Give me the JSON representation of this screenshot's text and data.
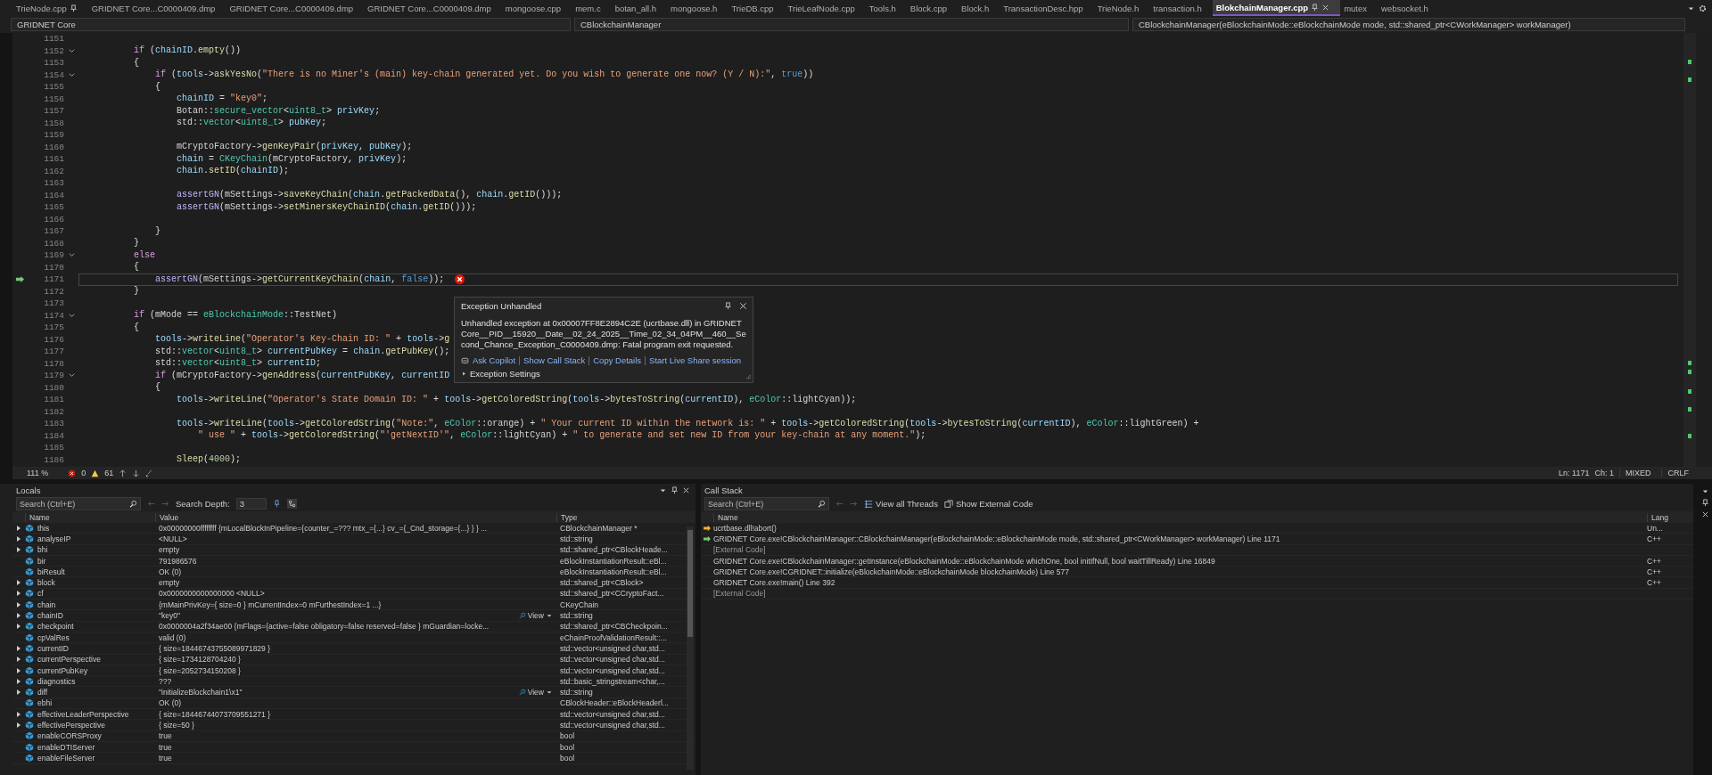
{
  "tabs": [
    {
      "label": "TrieNode.cpp",
      "selected": false,
      "pinned": true
    },
    {
      "label": "GRIDNET Core...C0000409.dmp",
      "selected": false,
      "pinned": false
    },
    {
      "label": "GRIDNET Core...C0000409.dmp",
      "selected": false,
      "pinned": false
    },
    {
      "label": "GRIDNET Core...C0000409.dmp",
      "selected": false,
      "pinned": false
    },
    {
      "label": "mongoose.cpp",
      "selected": false,
      "pinned": false
    },
    {
      "label": "mem.c",
      "selected": false,
      "pinned": false
    },
    {
      "label": "botan_all.h",
      "selected": false,
      "pinned": false
    },
    {
      "label": "mongoose.h",
      "selected": false,
      "pinned": false
    },
    {
      "label": "TrieDB.cpp",
      "selected": false,
      "pinned": false
    },
    {
      "label": "TrieLeafNode.cpp",
      "selected": false,
      "pinned": false
    },
    {
      "label": "Tools.h",
      "selected": false,
      "pinned": false
    },
    {
      "label": "Block.cpp",
      "selected": false,
      "pinned": false
    },
    {
      "label": "Block.h",
      "selected": false,
      "pinned": false
    },
    {
      "label": "TransactionDesc.hpp",
      "selected": false,
      "pinned": false
    },
    {
      "label": "TrieNode.h",
      "selected": false,
      "pinned": false
    },
    {
      "label": "transaction.h",
      "selected": false,
      "pinned": false
    },
    {
      "label": "BlokchainManager.cpp",
      "selected": true,
      "pinned": true
    },
    {
      "label": "mutex",
      "selected": false,
      "pinned": false
    },
    {
      "label": "websocket.h",
      "selected": false,
      "pinned": false
    }
  ],
  "nav_bar": {
    "project": "GRIDNET Core",
    "scope": "CBlockchainManager",
    "member": "CBlockchainManager(eBlockchainMode::eBlockchainMode mode, std::shared_ptr<CWorkManager> workManager)"
  },
  "editor": {
    "lines": [
      {
        "number": "1151",
        "fold": false,
        "current": false,
        "error": false
      },
      {
        "number": "1152",
        "fold": true,
        "current": false,
        "error": false,
        "tokens": [
          {
            "kind": "keyword",
            "text": "        if"
          },
          {
            "kind": "plain",
            "text": " ("
          },
          {
            "kind": "variable",
            "text": "chainID"
          },
          {
            "kind": "plain",
            "text": "."
          },
          {
            "kind": "function",
            "text": "empty"
          },
          {
            "kind": "plain",
            "text": "())"
          }
        ]
      },
      {
        "number": "1153",
        "fold": false,
        "current": false,
        "error": false,
        "tokens": [
          {
            "kind": "plain",
            "text": "        {"
          }
        ]
      },
      {
        "number": "1154",
        "fold": true,
        "current": false,
        "error": false,
        "tokens": [
          {
            "kind": "keyword",
            "text": "            if"
          },
          {
            "kind": "plain",
            "text": " ("
          },
          {
            "kind": "variable",
            "text": "tools"
          },
          {
            "kind": "plain",
            "text": "->"
          },
          {
            "kind": "function",
            "text": "askYesNo"
          },
          {
            "kind": "plain",
            "text": "("
          },
          {
            "kind": "string",
            "text": "\"There is no Miner's (main) key-chain generated yet. Do you wish to generate one now? (Y / N):\""
          },
          {
            "kind": "plain",
            "text": ", "
          },
          {
            "kind": "bool",
            "text": "true"
          },
          {
            "kind": "plain",
            "text": "))"
          }
        ]
      },
      {
        "number": "1155",
        "fold": false,
        "current": false,
        "error": false,
        "tokens": [
          {
            "kind": "plain",
            "text": "            {"
          }
        ]
      },
      {
        "number": "1156",
        "fold": false,
        "current": false,
        "error": false,
        "tokens": [
          {
            "kind": "variable",
            "text": "                chainID"
          },
          {
            "kind": "plain",
            "text": " = "
          },
          {
            "kind": "string",
            "text": "\"key0\""
          },
          {
            "kind": "plain",
            "text": ";"
          }
        ]
      },
      {
        "number": "1157",
        "fold": false,
        "current": false,
        "error": false,
        "tokens": [
          {
            "kind": "name",
            "text": "                Botan"
          },
          {
            "kind": "plain",
            "text": "::"
          },
          {
            "kind": "type",
            "text": "secure_vector"
          },
          {
            "kind": "plain",
            "text": "<"
          },
          {
            "kind": "type",
            "text": "uint8_t"
          },
          {
            "kind": "plain",
            "text": "> "
          },
          {
            "kind": "variable",
            "text": "privKey"
          },
          {
            "kind": "plain",
            "text": ";"
          }
        ]
      },
      {
        "number": "1158",
        "fold": false,
        "current": false,
        "error": false,
        "tokens": [
          {
            "kind": "name",
            "text": "                std"
          },
          {
            "kind": "plain",
            "text": "::"
          },
          {
            "kind": "type",
            "text": "vector"
          },
          {
            "kind": "plain",
            "text": "<"
          },
          {
            "kind": "type",
            "text": "uint8_t"
          },
          {
            "kind": "plain",
            "text": "> "
          },
          {
            "kind": "variable",
            "text": "pubKey"
          },
          {
            "kind": "plain",
            "text": ";"
          }
        ]
      },
      {
        "number": "1159",
        "fold": false,
        "current": false,
        "error": false
      },
      {
        "number": "1160",
        "fold": false,
        "current": false,
        "error": false,
        "tokens": [
          {
            "kind": "name",
            "text": "                mCryptoFactory"
          },
          {
            "kind": "plain",
            "text": "->"
          },
          {
            "kind": "function",
            "text": "genKeyPair"
          },
          {
            "kind": "plain",
            "text": "("
          },
          {
            "kind": "variable",
            "text": "privKey"
          },
          {
            "kind": "plain",
            "text": ", "
          },
          {
            "kind": "variable",
            "text": "pubKey"
          },
          {
            "kind": "plain",
            "text": ");"
          }
        ]
      },
      {
        "number": "1161",
        "fold": false,
        "current": false,
        "error": false,
        "tokens": [
          {
            "kind": "variable",
            "text": "                chain"
          },
          {
            "kind": "plain",
            "text": " = "
          },
          {
            "kind": "type",
            "text": "CKeyChain"
          },
          {
            "kind": "plain",
            "text": "("
          },
          {
            "kind": "name",
            "text": "mCryptoFactory"
          },
          {
            "kind": "plain",
            "text": ", "
          },
          {
            "kind": "variable",
            "text": "privKey"
          },
          {
            "kind": "plain",
            "text": ");"
          }
        ]
      },
      {
        "number": "1162",
        "fold": false,
        "current": false,
        "error": false,
        "tokens": [
          {
            "kind": "variable",
            "text": "                chain"
          },
          {
            "kind": "plain",
            "text": "."
          },
          {
            "kind": "function",
            "text": "setID"
          },
          {
            "kind": "plain",
            "text": "("
          },
          {
            "kind": "variable",
            "text": "chainID"
          },
          {
            "kind": "plain",
            "text": ");"
          }
        ]
      },
      {
        "number": "1163",
        "fold": false,
        "current": false,
        "error": false
      },
      {
        "number": "1164",
        "fold": false,
        "current": false,
        "error": false,
        "tokens": [
          {
            "kind": "macro",
            "text": "                assertGN"
          },
          {
            "kind": "plain",
            "text": "("
          },
          {
            "kind": "name",
            "text": "mSettings"
          },
          {
            "kind": "plain",
            "text": "->"
          },
          {
            "kind": "function",
            "text": "saveKeyChain"
          },
          {
            "kind": "plain",
            "text": "("
          },
          {
            "kind": "variable",
            "text": "chain"
          },
          {
            "kind": "plain",
            "text": "."
          },
          {
            "kind": "function",
            "text": "getPackedData"
          },
          {
            "kind": "plain",
            "text": "(), "
          },
          {
            "kind": "variable",
            "text": "chain"
          },
          {
            "kind": "plain",
            "text": "."
          },
          {
            "kind": "function",
            "text": "getID"
          },
          {
            "kind": "plain",
            "text": "()));"
          }
        ]
      },
      {
        "number": "1165",
        "fold": false,
        "current": false,
        "error": false,
        "tokens": [
          {
            "kind": "macro",
            "text": "                assertGN"
          },
          {
            "kind": "plain",
            "text": "("
          },
          {
            "kind": "name",
            "text": "mSettings"
          },
          {
            "kind": "plain",
            "text": "->"
          },
          {
            "kind": "function",
            "text": "setMinersKeyChainID"
          },
          {
            "kind": "plain",
            "text": "("
          },
          {
            "kind": "variable",
            "text": "chain"
          },
          {
            "kind": "plain",
            "text": "."
          },
          {
            "kind": "function",
            "text": "getID"
          },
          {
            "kind": "plain",
            "text": "()));"
          }
        ]
      },
      {
        "number": "1166",
        "fold": false,
        "current": false,
        "error": false
      },
      {
        "number": "1167",
        "fold": false,
        "current": false,
        "error": false,
        "tokens": [
          {
            "kind": "plain",
            "text": "            }"
          }
        ]
      },
      {
        "number": "1168",
        "fold": false,
        "current": false,
        "error": false,
        "tokens": [
          {
            "kind": "plain",
            "text": "        }"
          }
        ]
      },
      {
        "number": "1169",
        "fold": true,
        "current": false,
        "error": false,
        "tokens": [
          {
            "kind": "keyword",
            "text": "        else"
          }
        ]
      },
      {
        "number": "1170",
        "fold": false,
        "current": false,
        "error": false,
        "tokens": [
          {
            "kind": "plain",
            "text": "        {"
          }
        ]
      },
      {
        "number": "1171",
        "fold": false,
        "current": true,
        "error": true,
        "tokens": [
          {
            "kind": "macro",
            "text": "            assertGN"
          },
          {
            "kind": "plain",
            "text": "("
          },
          {
            "kind": "name",
            "text": "mSettings"
          },
          {
            "kind": "plain",
            "text": "->"
          },
          {
            "kind": "function",
            "text": "getCurrentKeyChain"
          },
          {
            "kind": "plain",
            "text": "("
          },
          {
            "kind": "variable",
            "text": "chain"
          },
          {
            "kind": "plain",
            "text": ", "
          },
          {
            "kind": "bool",
            "text": "false"
          },
          {
            "kind": "plain",
            "text": "));"
          }
        ]
      },
      {
        "number": "1172",
        "fold": false,
        "current": false,
        "error": false,
        "tokens": [
          {
            "kind": "plain",
            "text": "        }"
          }
        ]
      },
      {
        "number": "1173",
        "fold": false,
        "current": false,
        "error": false
      },
      {
        "number": "1174",
        "fold": true,
        "current": false,
        "error": false,
        "tokens": [
          {
            "kind": "keyword",
            "text": "        if"
          },
          {
            "kind": "plain",
            "text": " ("
          },
          {
            "kind": "name",
            "text": "mMode"
          },
          {
            "kind": "plain",
            "text": " == "
          },
          {
            "kind": "type",
            "text": "eBlockchainMode"
          },
          {
            "kind": "plain",
            "text": "::"
          },
          {
            "kind": "name",
            "text": "TestNet"
          },
          {
            "kind": "plain",
            "text": ")"
          }
        ]
      },
      {
        "number": "1175",
        "fold": false,
        "current": false,
        "error": false,
        "tokens": [
          {
            "kind": "plain",
            "text": "        {"
          }
        ]
      },
      {
        "number": "1176",
        "fold": false,
        "current": false,
        "error": false,
        "tokens": [
          {
            "kind": "variable",
            "text": "            tools"
          },
          {
            "kind": "plain",
            "text": "->"
          },
          {
            "kind": "function",
            "text": "writeLine"
          },
          {
            "kind": "plain",
            "text": "("
          },
          {
            "kind": "string",
            "text": "\"Operator's Key-Chain ID: \""
          },
          {
            "kind": "plain",
            "text": " + "
          },
          {
            "kind": "variable",
            "text": "tools"
          },
          {
            "kind": "plain",
            "text": "->"
          },
          {
            "kind": "function",
            "text": "g"
          }
        ]
      },
      {
        "number": "1177",
        "fold": false,
        "current": false,
        "error": false,
        "tokens": [
          {
            "kind": "name",
            "text": "            std"
          },
          {
            "kind": "plain",
            "text": "::"
          },
          {
            "kind": "type",
            "text": "vector"
          },
          {
            "kind": "plain",
            "text": "<"
          },
          {
            "kind": "type",
            "text": "uint8_t"
          },
          {
            "kind": "plain",
            "text": "> "
          },
          {
            "kind": "variable",
            "text": "currentPubKey"
          },
          {
            "kind": "plain",
            "text": " = "
          },
          {
            "kind": "variable",
            "text": "chain"
          },
          {
            "kind": "plain",
            "text": "."
          },
          {
            "kind": "function",
            "text": "getPubKey"
          },
          {
            "kind": "plain",
            "text": "();"
          }
        ]
      },
      {
        "number": "1178",
        "fold": false,
        "current": false,
        "error": false,
        "tokens": [
          {
            "kind": "name",
            "text": "            std"
          },
          {
            "kind": "plain",
            "text": "::"
          },
          {
            "kind": "type",
            "text": "vector"
          },
          {
            "kind": "plain",
            "text": "<"
          },
          {
            "kind": "type",
            "text": "uint8_t"
          },
          {
            "kind": "plain",
            "text": "> "
          },
          {
            "kind": "variable",
            "text": "currentID"
          },
          {
            "kind": "plain",
            "text": ";"
          }
        ]
      },
      {
        "number": "1179",
        "fold": true,
        "current": false,
        "error": false,
        "tokens": [
          {
            "kind": "keyword",
            "text": "            if"
          },
          {
            "kind": "plain",
            "text": " ("
          },
          {
            "kind": "name",
            "text": "mCryptoFactory"
          },
          {
            "kind": "plain",
            "text": "->"
          },
          {
            "kind": "function",
            "text": "genAddress"
          },
          {
            "kind": "plain",
            "text": "("
          },
          {
            "kind": "variable",
            "text": "currentPubKey"
          },
          {
            "kind": "plain",
            "text": ", "
          },
          {
            "kind": "variable",
            "text": "currentID"
          }
        ]
      },
      {
        "number": "1180",
        "fold": false,
        "current": false,
        "error": false,
        "tokens": [
          {
            "kind": "plain",
            "text": "            {"
          }
        ]
      },
      {
        "number": "1181",
        "fold": false,
        "current": false,
        "error": false,
        "tokens": [
          {
            "kind": "variable",
            "text": "                tools"
          },
          {
            "kind": "plain",
            "text": "->"
          },
          {
            "kind": "function",
            "text": "writeLine"
          },
          {
            "kind": "plain",
            "text": "("
          },
          {
            "kind": "string",
            "text": "\"Operator's State Domain ID: \""
          },
          {
            "kind": "plain",
            "text": " + "
          },
          {
            "kind": "variable",
            "text": "tools"
          },
          {
            "kind": "plain",
            "text": "->"
          },
          {
            "kind": "function",
            "text": "getColoredString"
          },
          {
            "kind": "plain",
            "text": "("
          },
          {
            "kind": "variable",
            "text": "tools"
          },
          {
            "kind": "plain",
            "text": "->"
          },
          {
            "kind": "function",
            "text": "bytesToString"
          },
          {
            "kind": "plain",
            "text": "("
          },
          {
            "kind": "variable",
            "text": "currentID"
          },
          {
            "kind": "plain",
            "text": "), "
          },
          {
            "kind": "type",
            "text": "eColor"
          },
          {
            "kind": "plain",
            "text": "::"
          },
          {
            "kind": "name",
            "text": "lightCyan"
          },
          {
            "kind": "plain",
            "text": "));"
          }
        ]
      },
      {
        "number": "1182",
        "fold": false,
        "current": false,
        "error": false
      },
      {
        "number": "1183",
        "fold": false,
        "current": false,
        "error": false,
        "tokens": [
          {
            "kind": "variable",
            "text": "                tools"
          },
          {
            "kind": "plain",
            "text": "->"
          },
          {
            "kind": "function",
            "text": "writeLine"
          },
          {
            "kind": "plain",
            "text": "("
          },
          {
            "kind": "variable",
            "text": "tools"
          },
          {
            "kind": "plain",
            "text": "->"
          },
          {
            "kind": "function",
            "text": "getColoredString"
          },
          {
            "kind": "plain",
            "text": "("
          },
          {
            "kind": "string",
            "text": "\"Note:\""
          },
          {
            "kind": "plain",
            "text": ", "
          },
          {
            "kind": "type",
            "text": "eColor"
          },
          {
            "kind": "plain",
            "text": "::"
          },
          {
            "kind": "name",
            "text": "orange"
          },
          {
            "kind": "plain",
            "text": ") + "
          },
          {
            "kind": "string",
            "text": "\" Your current ID within the network is: \""
          },
          {
            "kind": "plain",
            "text": " + "
          },
          {
            "kind": "variable",
            "text": "tools"
          },
          {
            "kind": "plain",
            "text": "->"
          },
          {
            "kind": "function",
            "text": "getColoredString"
          },
          {
            "kind": "plain",
            "text": "("
          },
          {
            "kind": "variable",
            "text": "tools"
          },
          {
            "kind": "plain",
            "text": "->"
          },
          {
            "kind": "function",
            "text": "bytesToString"
          },
          {
            "kind": "plain",
            "text": "("
          },
          {
            "kind": "variable",
            "text": "currentID"
          },
          {
            "kind": "plain",
            "text": "), "
          },
          {
            "kind": "type",
            "text": "eColor"
          },
          {
            "kind": "plain",
            "text": "::"
          },
          {
            "kind": "name",
            "text": "lightGreen"
          },
          {
            "kind": "plain",
            "text": ") +"
          }
        ]
      },
      {
        "number": "1184",
        "fold": false,
        "current": false,
        "error": false,
        "tokens": [
          {
            "kind": "string",
            "text": "                    \" use \""
          },
          {
            "kind": "plain",
            "text": " + "
          },
          {
            "kind": "variable",
            "text": "tools"
          },
          {
            "kind": "plain",
            "text": "->"
          },
          {
            "kind": "function",
            "text": "getColoredString"
          },
          {
            "kind": "plain",
            "text": "("
          },
          {
            "kind": "string",
            "text": "\"'getNextID'\""
          },
          {
            "kind": "plain",
            "text": ", "
          },
          {
            "kind": "type",
            "text": "eColor"
          },
          {
            "kind": "plain",
            "text": "::"
          },
          {
            "kind": "name",
            "text": "lightCyan"
          },
          {
            "kind": "plain",
            "text": ") + "
          },
          {
            "kind": "string",
            "text": "\" to generate and set new ID from your key-chain at any moment.\""
          },
          {
            "kind": "plain",
            "text": ");"
          }
        ]
      },
      {
        "number": "1185",
        "fold": false,
        "current": false,
        "error": false
      },
      {
        "number": "1186",
        "fold": false,
        "current": false,
        "error": false,
        "tokens": [
          {
            "kind": "function",
            "text": "                Sleep"
          },
          {
            "kind": "plain",
            "text": "("
          },
          {
            "kind": "number",
            "text": "4000"
          },
          {
            "kind": "plain",
            "text": ");"
          }
        ]
      }
    ]
  },
  "exception_popup": {
    "title": "Exception Unhandled",
    "message": "Unhandled exception at 0x00007FF8E2894C2E (ucrtbase.dll) in GRIDNET Core__PID__15920__Date__02_24_2025__Time_02_34_04PM__460__Second_Chance_Exception_C0000409.dmp: Fatal program exit requested.",
    "links": [
      "Ask Copilot",
      "Show Call Stack",
      "Copy Details",
      "Start Live Share session"
    ],
    "settings": "Exception Settings"
  },
  "editor_status": {
    "zoom": "111 %",
    "errors": "0",
    "warnings": "61",
    "line": "Ln: 1171",
    "column": "Ch: 1",
    "indentation": "MIXED",
    "line_endings": "CRLF"
  },
  "locals": {
    "title": "Locals",
    "search": {
      "placeholder": "Search (Ctrl+E)"
    },
    "depth_label": "Search Depth:",
    "depth": "3",
    "columns": [
      "Name",
      "Value",
      "Type"
    ],
    "rows": [
      {
        "name": "this",
        "value": "0x00000000ffffffff {mLocalBlockInPipeline={counter_=??? mtx_={...} cv_={_Cnd_storage={...} } } ...",
        "type": "CBlockchainManager *",
        "expandable": true
      },
      {
        "name": "analyseIP",
        "value": "<NULL>",
        "type": "std::string",
        "expandable": true
      },
      {
        "name": "bhi",
        "value": "empty",
        "type": "std::shared_ptr<CBlockHeade...",
        "expandable": true
      },
      {
        "name": "bir",
        "value": "791986576",
        "type": "eBlockInstantiationResult::eBl...",
        "expandable": false
      },
      {
        "name": "biResult",
        "value": "OK (0)",
        "type": "eBlockInstantiationResult::eBl...",
        "expandable": false
      },
      {
        "name": "block",
        "value": "empty",
        "type": "std::shared_ptr<CBlock>",
        "expandable": true
      },
      {
        "name": "cf",
        "value": "0x0000000000000000 <NULL>",
        "type": "std::shared_ptr<CCryptoFact...",
        "expandable": true
      },
      {
        "name": "chain",
        "value": "{mMainPrivKey={ size=0 } mCurrentIndex=0 mFurthestIndex=1 ...}",
        "type": "CKeyChain",
        "expandable": true
      },
      {
        "name": "chainID",
        "value": "\"key0\"",
        "view": "View",
        "type": "std::string",
        "expandable": true
      },
      {
        "name": "checkpoint",
        "value": "0x0000004a2f34ae00 {mFlags={active=false obligatory=false reserved=false } mGuardian=locke...",
        "type": "std::shared_ptr<CBCheckpoin...",
        "expandable": true
      },
      {
        "name": "cpValRes",
        "value": "valid (0)",
        "type": "eChainProofValidationResult::...",
        "expandable": false
      },
      {
        "name": "currentID",
        "value": "{ size=18446743755089971829 }",
        "type": "std::vector<unsigned char,std...",
        "expandable": true
      },
      {
        "name": "currentPerspective",
        "value": "{ size=1734128704240 }",
        "type": "std::vector<unsigned char,std...",
        "expandable": true
      },
      {
        "name": "currentPubKey",
        "value": "{ size=2052734150208 }",
        "type": "std::vector<unsigned char,std...",
        "expandable": true
      },
      {
        "name": "diagnostics",
        "value": "???",
        "type": "std::basic_stringstream<char,...",
        "expandable": true
      },
      {
        "name": "diff",
        "value": "\"initializeBlockchain1\\x1\"",
        "view": "View",
        "type": "std::string",
        "expandable": true
      },
      {
        "name": "ebhi",
        "value": "OK (0)",
        "type": "CBlockHeader::eBlockHeaderl...",
        "expandable": false
      },
      {
        "name": "effectiveLeaderPerspective",
        "value": "{ size=18446744073709551271 }",
        "type": "std::vector<unsigned char,std...",
        "expandable": true
      },
      {
        "name": "effectivePerspective",
        "value": "{ size=50 }",
        "type": "std::vector<unsigned char,std...",
        "expandable": true
      },
      {
        "name": "enableCORSProxy",
        "value": "true",
        "type": "bool",
        "expandable": false
      },
      {
        "name": "enableDTIServer",
        "value": "true",
        "type": "bool",
        "expandable": false
      },
      {
        "name": "enableFileServer",
        "value": "true",
        "type": "bool",
        "expandable": false
      }
    ]
  },
  "call_stack": {
    "title": "Call Stack",
    "search": {
      "placeholder": "Search (Ctrl+E)"
    },
    "buttons": [
      "View all Threads",
      "Show External Code"
    ],
    "columns": [
      "Name",
      "Lang"
    ],
    "rows": [
      {
        "name": "ucrtbase.dll!abort()",
        "lang": "Un...",
        "kind": "current",
        "external": false
      },
      {
        "name": "GRIDNET Core.exe!CBlockchainManager::CBlockchainManager(eBlockchainMode::eBlockchainMode mode, std::shared_ptr<CWorkManager> workManager) Line 1171",
        "lang": "C++",
        "kind": "return",
        "external": false
      },
      {
        "name": "[External Code]",
        "kind": "frame",
        "external": true
      },
      {
        "name": "GRIDNET Core.exe!CBlockchainManager::getInstance(eBlockchainMode::eBlockchainMode whichOne, bool initIfNull, bool waitTillReady) Line 16849",
        "lang": "C++",
        "kind": "frame",
        "external": false
      },
      {
        "name": "GRIDNET Core.exe!CGRIDNET::initialize(eBlockchainMode::eBlockchainMode blockchainMode) Line 577",
        "lang": "C++",
        "kind": "frame",
        "external": false
      },
      {
        "name": "GRIDNET Core.exe!main() Line 392",
        "lang": "C++",
        "kind": "frame",
        "external": false
      },
      {
        "name": "[External Code]",
        "kind": "frame",
        "external": true
      }
    ]
  }
}
